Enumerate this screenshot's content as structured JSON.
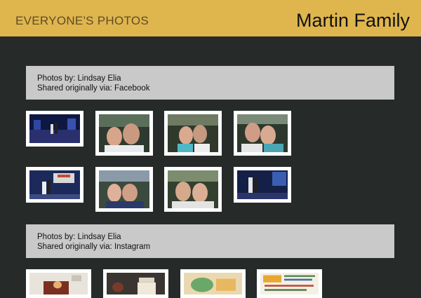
{
  "header": {
    "left_title": "EVERYONE'S PHOTOS",
    "right_title": "Martin Family"
  },
  "sections": [
    {
      "photos_by": "Photos by: Lindsay Elia",
      "shared_via": "Shared originally via: Facebook"
    },
    {
      "photos_by": "Photos by: Lindsay Elia",
      "shared_via": "Shared originally via: Instagram"
    }
  ],
  "colors": {
    "header_bg": "#dfb54e",
    "page_bg": "#262b2a",
    "info_bg": "#c9c9c9"
  }
}
